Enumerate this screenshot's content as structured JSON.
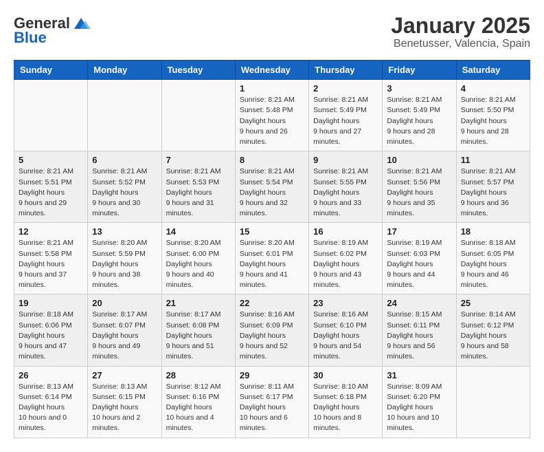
{
  "logo": {
    "general": "General",
    "blue": "Blue"
  },
  "title": "January 2025",
  "subtitle": "Benetusser, Valencia, Spain",
  "weekdays": [
    "Sunday",
    "Monday",
    "Tuesday",
    "Wednesday",
    "Thursday",
    "Friday",
    "Saturday"
  ],
  "weeks": [
    [
      null,
      null,
      null,
      {
        "day": 1,
        "sunrise": "8:21 AM",
        "sunset": "5:48 PM",
        "daylight": "9 hours and 26 minutes."
      },
      {
        "day": 2,
        "sunrise": "8:21 AM",
        "sunset": "5:49 PM",
        "daylight": "9 hours and 27 minutes."
      },
      {
        "day": 3,
        "sunrise": "8:21 AM",
        "sunset": "5:49 PM",
        "daylight": "9 hours and 28 minutes."
      },
      {
        "day": 4,
        "sunrise": "8:21 AM",
        "sunset": "5:50 PM",
        "daylight": "9 hours and 28 minutes."
      }
    ],
    [
      {
        "day": 5,
        "sunrise": "8:21 AM",
        "sunset": "5:51 PM",
        "daylight": "9 hours and 29 minutes."
      },
      {
        "day": 6,
        "sunrise": "8:21 AM",
        "sunset": "5:52 PM",
        "daylight": "9 hours and 30 minutes."
      },
      {
        "day": 7,
        "sunrise": "8:21 AM",
        "sunset": "5:53 PM",
        "daylight": "9 hours and 31 minutes."
      },
      {
        "day": 8,
        "sunrise": "8:21 AM",
        "sunset": "5:54 PM",
        "daylight": "9 hours and 32 minutes."
      },
      {
        "day": 9,
        "sunrise": "8:21 AM",
        "sunset": "5:55 PM",
        "daylight": "9 hours and 33 minutes."
      },
      {
        "day": 10,
        "sunrise": "8:21 AM",
        "sunset": "5:56 PM",
        "daylight": "9 hours and 35 minutes."
      },
      {
        "day": 11,
        "sunrise": "8:21 AM",
        "sunset": "5:57 PM",
        "daylight": "9 hours and 36 minutes."
      }
    ],
    [
      {
        "day": 12,
        "sunrise": "8:21 AM",
        "sunset": "5:58 PM",
        "daylight": "9 hours and 37 minutes."
      },
      {
        "day": 13,
        "sunrise": "8:20 AM",
        "sunset": "5:59 PM",
        "daylight": "9 hours and 38 minutes."
      },
      {
        "day": 14,
        "sunrise": "8:20 AM",
        "sunset": "6:00 PM",
        "daylight": "9 hours and 40 minutes."
      },
      {
        "day": 15,
        "sunrise": "8:20 AM",
        "sunset": "6:01 PM",
        "daylight": "9 hours and 41 minutes."
      },
      {
        "day": 16,
        "sunrise": "8:19 AM",
        "sunset": "6:02 PM",
        "daylight": "9 hours and 43 minutes."
      },
      {
        "day": 17,
        "sunrise": "8:19 AM",
        "sunset": "6:03 PM",
        "daylight": "9 hours and 44 minutes."
      },
      {
        "day": 18,
        "sunrise": "8:18 AM",
        "sunset": "6:05 PM",
        "daylight": "9 hours and 46 minutes."
      }
    ],
    [
      {
        "day": 19,
        "sunrise": "8:18 AM",
        "sunset": "6:06 PM",
        "daylight": "9 hours and 47 minutes."
      },
      {
        "day": 20,
        "sunrise": "8:17 AM",
        "sunset": "6:07 PM",
        "daylight": "9 hours and 49 minutes."
      },
      {
        "day": 21,
        "sunrise": "8:17 AM",
        "sunset": "6:08 PM",
        "daylight": "9 hours and 51 minutes."
      },
      {
        "day": 22,
        "sunrise": "8:16 AM",
        "sunset": "6:09 PM",
        "daylight": "9 hours and 52 minutes."
      },
      {
        "day": 23,
        "sunrise": "8:16 AM",
        "sunset": "6:10 PM",
        "daylight": "9 hours and 54 minutes."
      },
      {
        "day": 24,
        "sunrise": "8:15 AM",
        "sunset": "6:11 PM",
        "daylight": "9 hours and 56 minutes."
      },
      {
        "day": 25,
        "sunrise": "8:14 AM",
        "sunset": "6:12 PM",
        "daylight": "9 hours and 58 minutes."
      }
    ],
    [
      {
        "day": 26,
        "sunrise": "8:13 AM",
        "sunset": "6:14 PM",
        "daylight": "10 hours and 0 minutes."
      },
      {
        "day": 27,
        "sunrise": "8:13 AM",
        "sunset": "6:15 PM",
        "daylight": "10 hours and 2 minutes."
      },
      {
        "day": 28,
        "sunrise": "8:12 AM",
        "sunset": "6:16 PM",
        "daylight": "10 hours and 4 minutes."
      },
      {
        "day": 29,
        "sunrise": "8:11 AM",
        "sunset": "6:17 PM",
        "daylight": "10 hours and 6 minutes."
      },
      {
        "day": 30,
        "sunrise": "8:10 AM",
        "sunset": "6:18 PM",
        "daylight": "10 hours and 8 minutes."
      },
      {
        "day": 31,
        "sunrise": "8:09 AM",
        "sunset": "6:20 PM",
        "daylight": "10 hours and 10 minutes."
      },
      null
    ]
  ]
}
